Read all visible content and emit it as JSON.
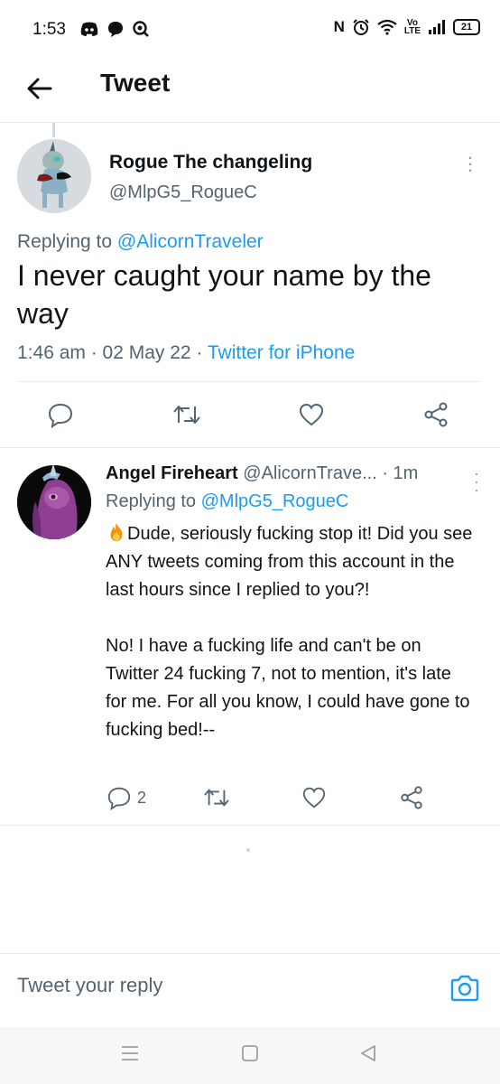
{
  "status_bar": {
    "time": "1:53",
    "battery": "21",
    "volte_top": "Vo",
    "volte_bottom": "LTE",
    "nfc_label": "N",
    "icons_left": [
      "discord-icon",
      "chat-bubble-icon",
      "search-badge-icon"
    ],
    "icons_right": [
      "nfc-icon",
      "alarm-icon",
      "wifi-icon",
      "volte-icon",
      "signal-icon",
      "battery-icon"
    ]
  },
  "header": {
    "title": "Tweet",
    "back_icon": "arrow-left-icon"
  },
  "main_tweet": {
    "author_name": "Rogue The changeling",
    "author_handle": "@MlpG5_RogueC",
    "replying_prefix": "Replying to ",
    "replying_to": "@AlicornTraveler",
    "text": "I never caught your name by the way",
    "timestamp": "1:46 am · 02 May 22 · ",
    "source": "Twitter for iPhone",
    "actions": [
      "reply-icon",
      "retweet-icon",
      "like-icon",
      "share-icon"
    ]
  },
  "reply_tweet": {
    "author_name": "Angel Fireheart",
    "author_handle": "@AlicornTrave...",
    "time_ago": "· 1m",
    "replying_prefix": "Replying to ",
    "replying_to": "@MlpG5_RogueC",
    "text": "Dude, seriously fucking stop it! Did you see ANY tweets coming from this account in the last hours since I replied to you?!\n\nNo! I have a fucking life and can't be on Twitter 24 fucking 7, not to mention, it's late for me. For all you know, I could have gone to fucking bed!--",
    "emoji": "fire-emoji",
    "reply_count": "2",
    "actions": [
      "reply-icon",
      "retweet-icon",
      "like-icon",
      "share-icon"
    ]
  },
  "composer": {
    "placeholder": "Tweet your reply",
    "camera_icon": "camera-icon"
  },
  "navbar": {
    "buttons": [
      "menu-icon",
      "home-square-icon",
      "back-triangle-icon"
    ]
  },
  "colors": {
    "accent": "#1d9bf0",
    "text_primary": "#0f1419",
    "text_secondary": "#536471",
    "divider": "#e6ecf0"
  }
}
